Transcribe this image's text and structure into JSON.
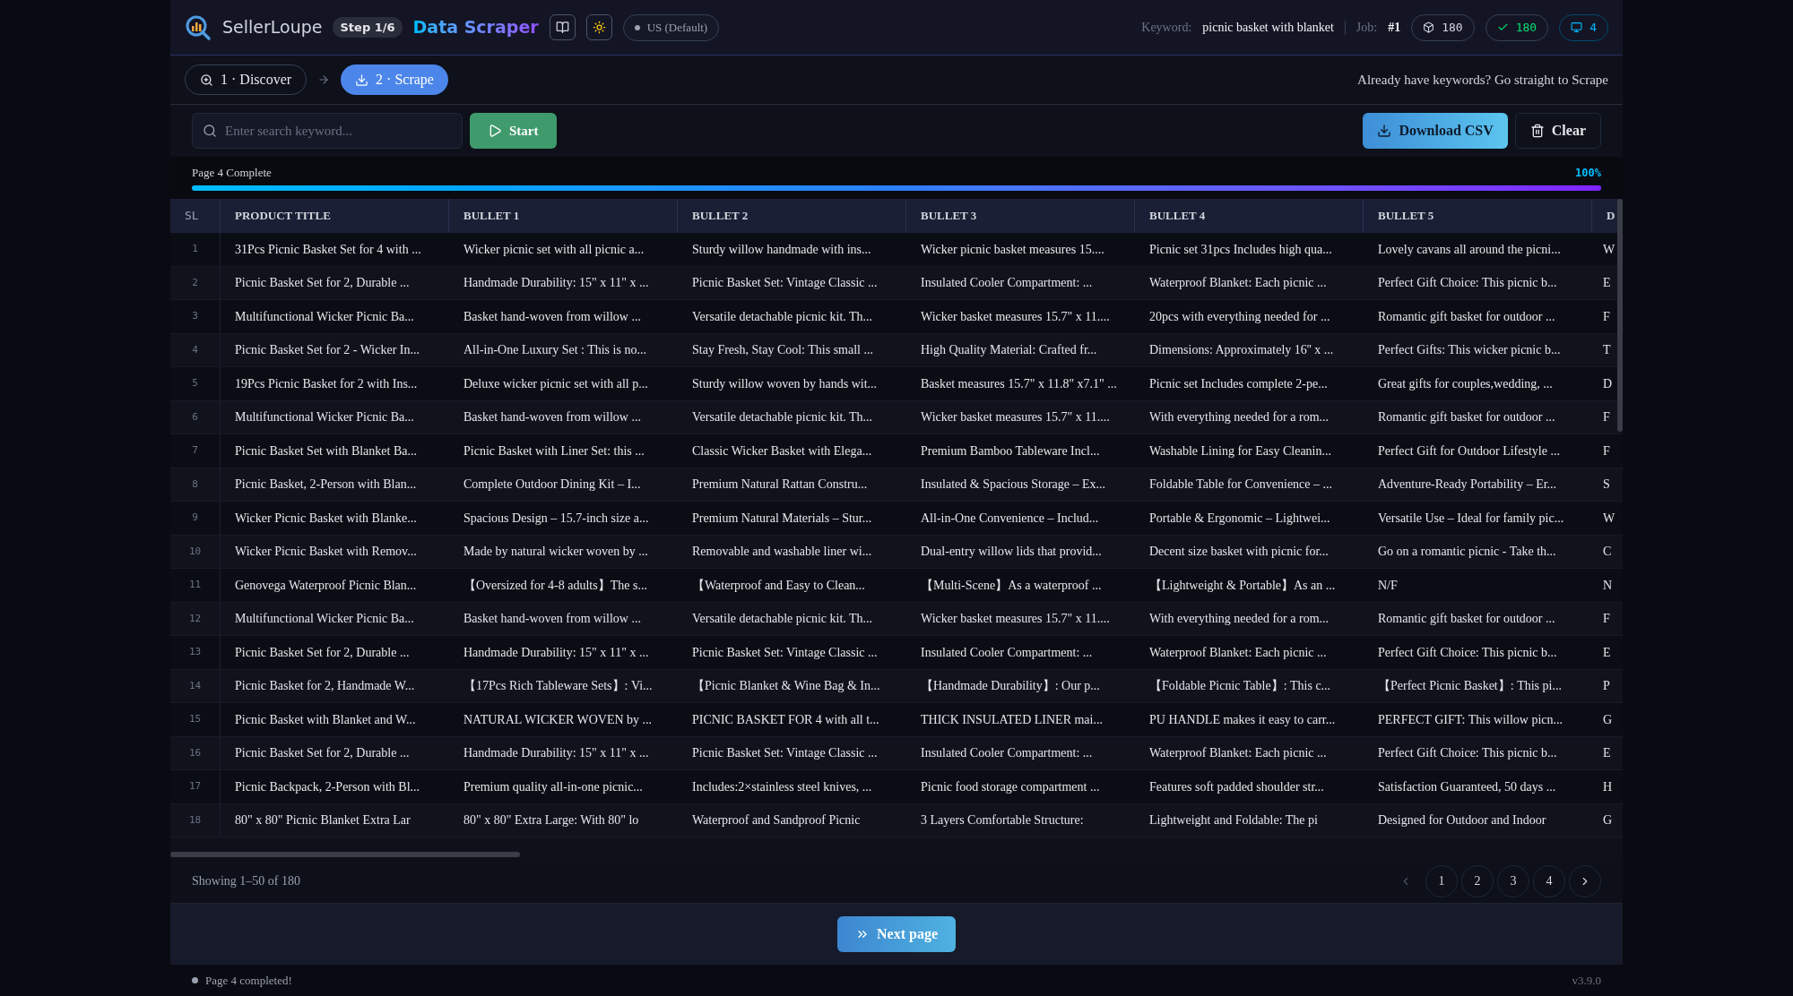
{
  "header": {
    "brand": "SellerLoupe",
    "step_badge": "Step 1/6",
    "title": "Data Scraper",
    "region": "US (Default)",
    "keyword_label": "Keyword:",
    "keyword": "picnic basket with blanket",
    "job_label": "Job:",
    "job": "#1",
    "stats": [
      {
        "kind": "total",
        "value": "180"
      },
      {
        "kind": "success",
        "value": "180"
      },
      {
        "kind": "pages",
        "value": "4"
      }
    ]
  },
  "steps": [
    {
      "label": "1 · Discover",
      "selected": false
    },
    {
      "label": "2 · Scrape",
      "selected": true
    }
  ],
  "steps_hint": "Already have keywords? Go straight to Scrape",
  "toolbar": {
    "search": {
      "placeholder": "Enter search keyword..."
    },
    "start": "Start",
    "download": "Download CSV",
    "clear": "Clear"
  },
  "progress": {
    "label": "Page 4 Complete",
    "percent": "100%",
    "level": 1
  },
  "table": {
    "columns": [
      "SL",
      "PRODUCT TITLE",
      "BULLET 1",
      "BULLET 2",
      "BULLET 3",
      "BULLET 4",
      "BULLET 5",
      "D"
    ],
    "rows": [
      [
        "1",
        "31Pcs Picnic Basket Set for 4 with ...",
        "Wicker picnic set with all picnic a...",
        "Sturdy willow handmade with ins...",
        "Wicker picnic basket measures 15....",
        "Picnic set 31pcs Includes high qua...",
        "Lovely cavans all around the picni...",
        "W"
      ],
      [
        "2",
        "Picnic Basket Set for 2, Durable ...",
        "Handmade Durability: 15\" x 11\" x ...",
        "Picnic Basket Set: Vintage Classic ...",
        "Insulated Cooler Compartment: ...",
        "Waterproof Blanket: Each picnic ...",
        "Perfect Gift Choice: This picnic b...",
        "E"
      ],
      [
        "3",
        "Multifunctional Wicker Picnic Ba...",
        "Basket hand-woven from willow ...",
        "Versatile detachable picnic kit. Th...",
        "Wicker basket measures 15.7\" x 11....",
        "20pcs with everything needed for ...",
        "Romantic gift basket for outdoor ...",
        "F"
      ],
      [
        "4",
        "Picnic Basket Set for 2 - Wicker In...",
        "All-in-One Luxury Set : This is no...",
        "Stay Fresh, Stay Cool: This small ...",
        "High Quality Material: Crafted fr...",
        "Dimensions: Approximately 16'' x ...",
        "Perfect Gifts: This wicker picnic b...",
        "T"
      ],
      [
        "5",
        "19Pcs Picnic Basket for 2 with Ins...",
        "Deluxe wicker picnic set with all p...",
        "Sturdy willow woven by hands wit...",
        "Basket measures 15.7\" x 11.8\" x7.1\" ...",
        "Picnic set Includes complete 2-pe...",
        "Great gifts for couples,wedding, ...",
        "D"
      ],
      [
        "6",
        "Multifunctional Wicker Picnic Ba...",
        "Basket hand-woven from willow ...",
        "Versatile detachable picnic kit. Th...",
        "Wicker basket measures 15.7\" x 11....",
        "With everything needed for a rom...",
        "Romantic gift basket for outdoor ...",
        "F"
      ],
      [
        "7",
        "Picnic Basket Set with Blanket Ba...",
        "Picnic Basket with Liner Set: this ...",
        "Classic Wicker Basket with Elega...",
        "Premium Bamboo Tableware Incl...",
        "Washable Lining for Easy Cleanin...",
        "Perfect Gift for Outdoor Lifestyle ...",
        "F"
      ],
      [
        "8",
        "Picnic Basket, 2-Person with Blan...",
        "Complete Outdoor Dining Kit – I...",
        "Premium Natural Rattan Constru...",
        "Insulated & Spacious Storage – Ex...",
        "Foldable Table for Convenience – ...",
        "Adventure-Ready Portability – Er...",
        "S"
      ],
      [
        "9",
        "Wicker Picnic Basket with Blanke...",
        "Spacious Design – 15.7-inch size a...",
        "Premium Natural Materials – Stur...",
        "All-in-One Convenience – Includ...",
        "Portable & Ergonomic – Lightwei...",
        "Versatile Use – Ideal for family pic...",
        "W"
      ],
      [
        "10",
        "Wicker Picnic Basket with Remov...",
        "Made by natural wicker woven by ...",
        "Removable and washable liner wi...",
        "Dual-entry willow lids that provid...",
        "Decent size basket with picnic for...",
        "Go on a romantic picnic - Take th...",
        "C"
      ],
      [
        "11",
        "Genovega Waterproof Picnic Blan...",
        "【Oversized for 4-8 adults】The s...",
        "【Waterproof and Easy to Clean...",
        "【Multi-Scene】As a waterproof ...",
        "【Lightweight & Portable】As an ...",
        "N/F",
        "N"
      ],
      [
        "12",
        "Multifunctional Wicker Picnic Ba...",
        "Basket hand-woven from willow ...",
        "Versatile detachable picnic kit. Th...",
        "Wicker basket measures 15.7\" x 11....",
        "With everything needed for a rom...",
        "Romantic gift basket for outdoor ...",
        "F"
      ],
      [
        "13",
        "Picnic Basket Set for 2, Durable ...",
        "Handmade Durability: 15\" x 11\" x ...",
        "Picnic Basket Set: Vintage Classic ...",
        "Insulated Cooler Compartment: ...",
        "Waterproof Blanket: Each picnic ...",
        "Perfect Gift Choice: This picnic b...",
        "E"
      ],
      [
        "14",
        "Picnic Basket for 2, Handmade W...",
        "【17Pcs Rich Tableware Sets】: Vi...",
        "【Picnic Blanket & Wine Bag & In...",
        "【Handmade Durability】: Our p...",
        "【Foldable Picnic Table】: This c...",
        "【Perfect Picnic Basket】: This pi...",
        "P"
      ],
      [
        "15",
        "Picnic Basket with Blanket and W...",
        "NATURAL WICKER WOVEN by ...",
        "PICNIC BASKET FOR 4 with all t...",
        "THICK INSULATED LINER mai...",
        "PU HANDLE makes it easy to carr...",
        "PERFECT GIFT: This willow picn...",
        "G"
      ],
      [
        "16",
        "Picnic Basket Set for 2, Durable ...",
        "Handmade Durability: 15\" x 11\" x ...",
        "Picnic Basket Set: Vintage Classic ...",
        "Insulated Cooler Compartment: ...",
        "Waterproof Blanket: Each picnic ...",
        "Perfect Gift Choice: This picnic b...",
        "E"
      ],
      [
        "17",
        "Picnic Backpack, 2-Person with Bl...",
        "Premium quality all-in-one picnic...",
        "Includes:2×stainless steel knives, ...",
        "Picnic food storage compartment ...",
        "Features soft padded shoulder str...",
        "Satisfaction Guaranteed, 50 days ...",
        "H"
      ],
      [
        "18",
        "80\" x 80\" Picnic Blanket Extra Lar",
        "80\" x 80\" Extra Large: With 80\" lo",
        "Waterproof and Sandproof Picnic",
        "3 Layers Comfortable Structure:",
        "Lightweight and Foldable: The pi",
        "Designed for Outdoor and Indoor",
        "G"
      ]
    ]
  },
  "pagination": {
    "summary": "Showing 1–50 of 180",
    "pages": [
      "1",
      "2",
      "3",
      "4"
    ]
  },
  "next_button": "Next page",
  "status": {
    "message": "Page 4 completed!",
    "version": "v3.9.0"
  }
}
